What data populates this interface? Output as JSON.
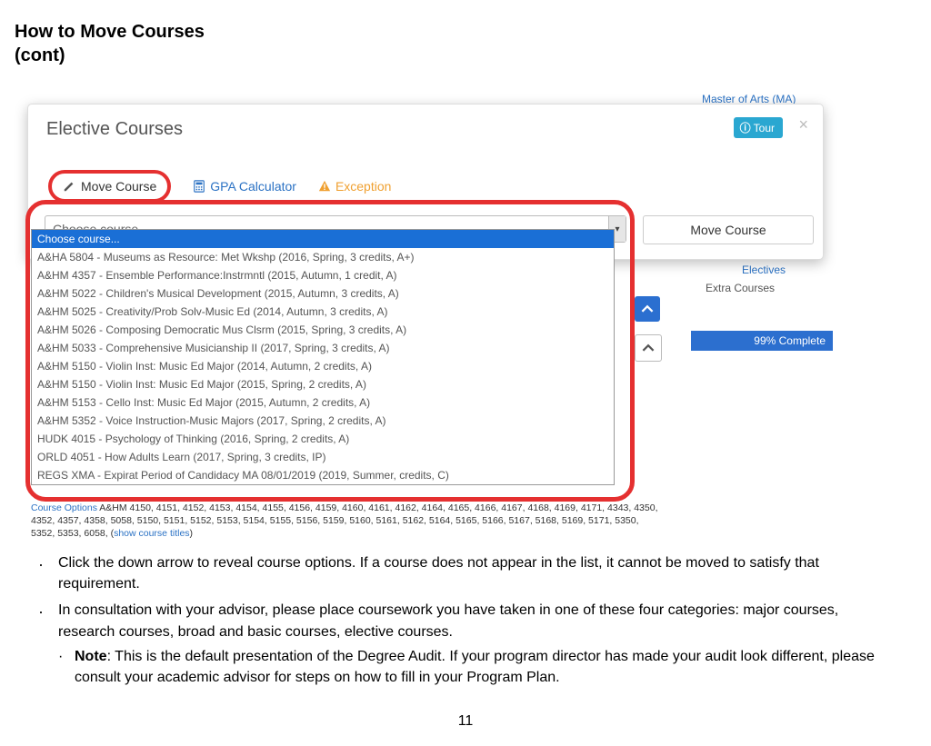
{
  "heading": {
    "line1": "How to Move Courses",
    "line2": "(cont)"
  },
  "panel": {
    "title": "Elective Courses",
    "tour": "Tour",
    "close": "×",
    "actions": {
      "move_course": "Move Course",
      "gpa_calc": "GPA Calculator",
      "exception": "Exception"
    },
    "select_placeholder": "Choose course...",
    "move_button": "Move Course"
  },
  "dropdown": {
    "items": [
      "Choose course...",
      "A&HA 5804 - Museums as Resource: Met Wkshp (2016, Spring, 3 credits, A+)",
      "A&HM 4357 - Ensemble Performance:Instrmntl (2015, Autumn, 1 credit, A)",
      "A&HM 5022 - Children's Musical Development (2015, Autumn, 3 credits, A)",
      "A&HM 5025 - Creativity/Prob Solv-Music Ed (2014, Autumn, 3 credits, A)",
      "A&HM 5026 - Composing Democratic Mus Clsrm (2015, Spring, 3 credits, A)",
      "A&HM 5033 - Comprehensive Musicianship II (2017, Spring, 3 credits, A)",
      "A&HM 5150 - Violin Inst: Music Ed Major (2014, Autumn, 2 credits, A)",
      "A&HM 5150 - Violin Inst: Music Ed Major (2015, Spring, 2 credits, A)",
      "A&HM 5153 - Cello Inst: Music Ed Major (2015, Autumn, 2 credits, A)",
      "A&HM 5352 - Voice Instruction-Music Majors (2017, Spring, 2 credits, A)",
      "HUDK 4015 - Psychology of Thinking (2016, Spring, 2 credits, A)",
      "ORLD 4051 - How Adults Learn (2017, Spring, 3 credits, IP)",
      "REGS XMA - Expirat Period of Candidacy MA 08/01/2019 (2019, Summer, credits, C)"
    ]
  },
  "side": {
    "degree": "Master of Arts (MA)",
    "electives": "Electives",
    "extra": "Extra Courses",
    "progress": "99% Complete"
  },
  "course_options": {
    "label": "Course Options",
    "body": " A&HM 4150, 4151, 4152, 4153, 4154, 4155, 4156, 4159, 4160, 4161, 4162, 4164, 4165, 4166, 4167, 4168, 4169, 4171, 4343, 4350, 4352, 4357, 4358, 5058, 5150, 5151, 5152, 5153, 5154, 5155, 5156, 5159, 5160, 5161, 5162, 5164, 5165, 5166, 5167, 5168, 5169, 5171, 5350, 5352, 5353, 6058, (",
    "link": "show course titles",
    "after": ")"
  },
  "bullets": {
    "b1": "Click the down arrow to reveal course options. If a course does not appear in the list, it cannot be moved to satisfy that requirement.",
    "b2": "In consultation with your advisor, please place coursework you have taken in one of these four categories: major courses, research courses, broad and basic courses, elective courses.",
    "b3_prefix": "Note",
    "b3_rest": ": This is the default presentation of the Degree Audit. If your program director has made your audit look different, please consult your academic advisor for steps on how to fill in your Program Plan."
  },
  "page_number": "11"
}
